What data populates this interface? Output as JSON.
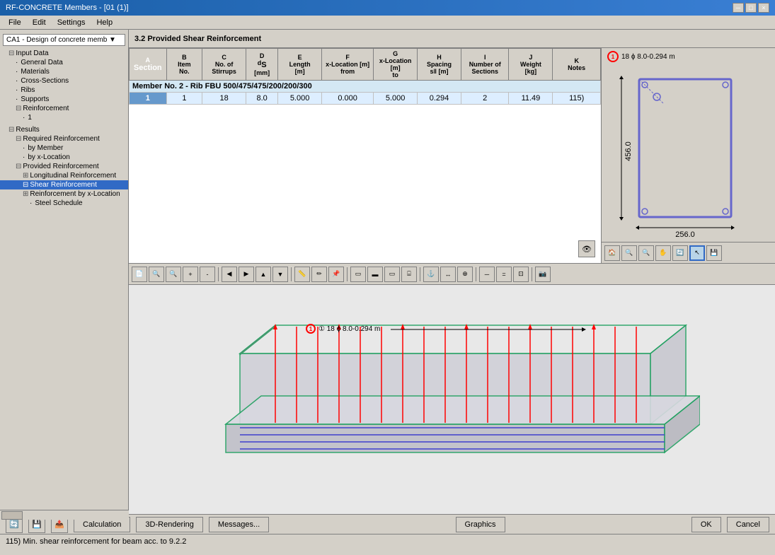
{
  "titleBar": {
    "title": "RF-CONCRETE Members - [01 (1)]",
    "closeIcon": "×",
    "minIcon": "─",
    "maxIcon": "□"
  },
  "menuBar": {
    "items": [
      "File",
      "Edit",
      "Settings",
      "Help"
    ]
  },
  "sidebarDropdown": {
    "label": "CA1 - Design of concrete memb ▼"
  },
  "sidebar": {
    "inputDataLabel": "Input Data",
    "items": [
      {
        "label": "General Data",
        "indent": "indent-2",
        "expand": false
      },
      {
        "label": "Materials",
        "indent": "indent-2",
        "expand": false
      },
      {
        "label": "Cross-Sections",
        "indent": "indent-2",
        "expand": false
      },
      {
        "label": "Ribs",
        "indent": "indent-2",
        "expand": false
      },
      {
        "label": "Supports",
        "indent": "indent-2",
        "expand": false
      },
      {
        "label": "Reinforcement",
        "indent": "indent-2",
        "expand": true
      },
      {
        "label": "1",
        "indent": "indent-3",
        "expand": false
      }
    ],
    "resultsLabel": "Results",
    "resultsItems": [
      {
        "label": "Required Reinforcement",
        "indent": "indent-2",
        "expand": true
      },
      {
        "label": "by Member",
        "indent": "indent-3",
        "expand": false
      },
      {
        "label": "by x-Location",
        "indent": "indent-3",
        "expand": false
      },
      {
        "label": "Provided Reinforcement",
        "indent": "indent-2",
        "expand": true
      },
      {
        "label": "Longitudinal Reinforcement",
        "indent": "indent-3",
        "expand": true
      },
      {
        "label": "Shear Reinforcement",
        "indent": "indent-3",
        "expand": true,
        "selected": true
      },
      {
        "label": "Reinforcement by x-Location",
        "indent": "indent-3",
        "expand": true
      },
      {
        "label": "Steel Schedule",
        "indent": "indent-4",
        "expand": false
      }
    ]
  },
  "sectionTitle": "3.2  Provided Shear Reinforcement",
  "tableColumns": {
    "A": {
      "header": "Section"
    },
    "B": {
      "header": "Item\nNo."
    },
    "C": {
      "header": "No. of\nStirups"
    },
    "D": {
      "header": "dS\n[mm]"
    },
    "E": {
      "header": "Length\n[m]"
    },
    "F": {
      "header": "x-Location [m]\nfrom"
    },
    "G": {
      "header": "x-Location [m]\nto"
    },
    "H": {
      "header": "Spacing\ns‖ [m]"
    },
    "I": {
      "header": "Number of\nSections"
    },
    "J": {
      "header": "Weight\n[kg]"
    },
    "K": {
      "header": "Notes"
    }
  },
  "memberRow": {
    "text": "Member No. 2 - Rib FBU 500/475/475/200/200/300"
  },
  "dataRow": {
    "section": "1",
    "itemNo": "1",
    "noOfStirups": "18",
    "ds": "8.0",
    "length": "5.000",
    "xFrom": "0.000",
    "xTo": "5.000",
    "spacing": "0.294",
    "numSections": "2",
    "weight": "11.49",
    "notes": "115)"
  },
  "crossSection": {
    "label": "18 ϕ 8.0-0.294 m",
    "circleNum": "1",
    "width": "256.0",
    "height": "456.0"
  },
  "annotation3d": {
    "label": "① 18 ϕ 8.0-0.294 m"
  },
  "bottomButtons": {
    "calculation": "Calculation",
    "rendering": "3D-Rendering",
    "messages": "Messages...",
    "graphics": "Graphics",
    "ok": "OK",
    "cancel": "Cancel"
  },
  "statusBar": {
    "text": "115) Min. shear reinforcement for beam acc. to 9.2.2"
  },
  "toolbarTools": [
    "📄",
    "🔍",
    "🔍",
    "📐",
    "📋",
    "📋",
    "➡",
    "⬅",
    "➡",
    "⬅",
    "📊",
    "🖊",
    "🖊",
    "📌",
    "💾",
    "📋",
    "📋",
    "📋",
    "📋",
    "📋",
    "📋",
    "📋",
    "📋",
    "📋",
    "📋",
    "📋",
    "📋",
    "📋",
    "📋",
    "📋",
    "📋"
  ],
  "accentColor": "#1a5fa8"
}
